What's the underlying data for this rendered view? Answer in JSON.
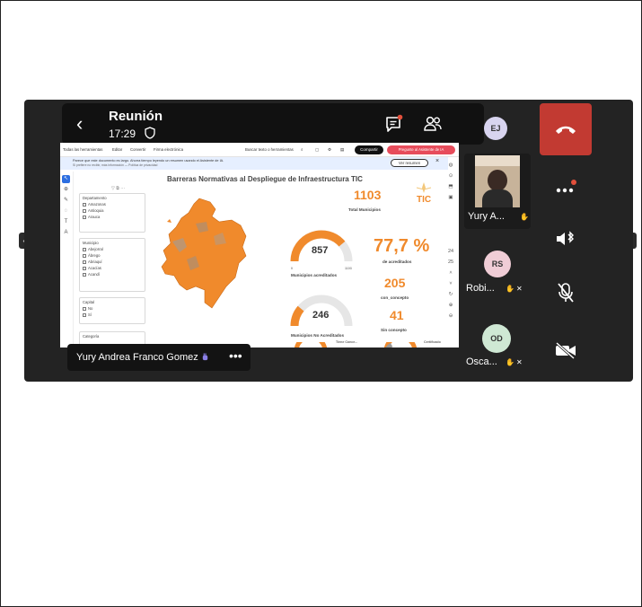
{
  "meeting": {
    "title": "Reunión",
    "time": "17:29"
  },
  "pdf_toolbar": {
    "all_tools": "Todas las herramientas",
    "edit": "Editar",
    "convert": "Convertir",
    "esign": "Firma electrónica",
    "search": "Buscar texto o herramientas",
    "share": "Compartir",
    "ask": "Pregunte al Asistente de IA"
  },
  "notice": {
    "text": "Parece que este documento es largo. Ahorra tiempo leyendo un resumen usando el Asistente de IA.",
    "sub": "Si prefiere no recibir, más información — Política de privacidad",
    "button": "Ver resumen"
  },
  "report": {
    "title": "Barreras Normativas al Despliegue de Infraestructura TIC",
    "logo_text": "TIC",
    "filters": [
      {
        "title": "Departamento",
        "options": [
          "Amazonas",
          "Antioquia",
          "Arauca"
        ]
      },
      {
        "title": "Municipio",
        "options": [
          "Abejorral",
          "Ábrego",
          "Abriaquí",
          "Acacías",
          "Acandí"
        ]
      },
      {
        "title": "Capital",
        "options": [
          "No",
          "Sí"
        ]
      },
      {
        "title": "Categoría",
        "options": []
      }
    ],
    "kpis": {
      "total_municipios_value": "1103",
      "total_municipios_label": "Total Municipios",
      "acreditados_value": "857",
      "acreditados_label": "Municipios acreditados",
      "acreditados_max": "1103",
      "acreditados_min": "0",
      "pct_value": "77,7 %",
      "pct_label": "de acreditados",
      "con_concepto_value": "205",
      "con_concepto_label": "con_concepto",
      "no_acreditados_value": "246",
      "no_acreditados_label": "Municipios No Acreditados",
      "sin_concepto_value": "41",
      "sin_concepto_label": "Sin concepto"
    },
    "bottom_labels": [
      "Tiene Conce...",
      "Certificado"
    ],
    "gauge_fill": {
      "acreditados": 0.777,
      "no_acreditados": 0.223
    }
  },
  "speaker": {
    "name": "Yury Andrea Franco Gomez",
    "more": "•••"
  },
  "participants": [
    {
      "initials": "EJ",
      "name": ""
    },
    {
      "initials": "",
      "name": "Yury A..."
    },
    {
      "initials": "RS",
      "name": "Robi..."
    },
    {
      "initials": "OD",
      "name": "Osca..."
    }
  ],
  "colors": {
    "accent": "#f08a2c",
    "hangup": "#c23a32",
    "avatar_ej": "#d8d4ef",
    "avatar_rs": "#f0cdd6",
    "avatar_od": "#cfe8d4"
  },
  "icons": [
    "back-icon",
    "shield-icon",
    "chat-icon",
    "people-icon",
    "hangup-icon",
    "more-icon",
    "speaker-bluetooth-icon",
    "mic-off-icon",
    "camera-off-icon"
  ]
}
